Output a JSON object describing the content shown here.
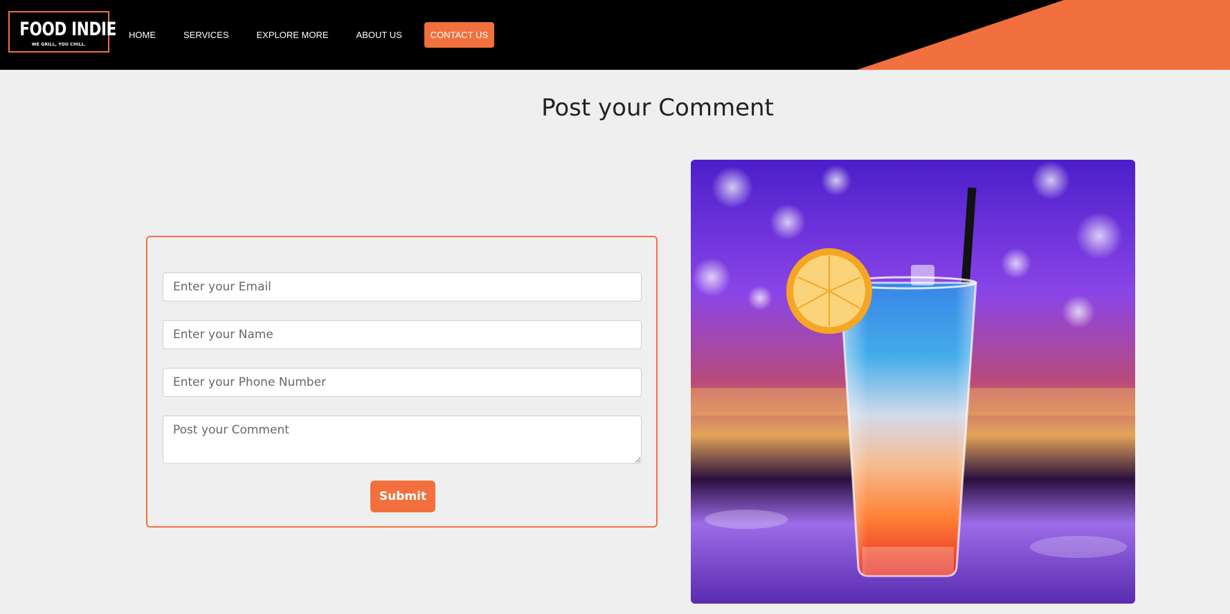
{
  "brand": {
    "name": "FOOD INDIE",
    "tagline": "WE GRILL, YOU CHILL."
  },
  "nav": {
    "links": [
      "HOME",
      "SERVICES",
      "EXPLORE MORE",
      "ABOUT US"
    ],
    "cta": "CONTACT US"
  },
  "main": {
    "title": "Post your Comment"
  },
  "form": {
    "email": {
      "value": "",
      "placeholder": "Enter your Email"
    },
    "name": {
      "value": "",
      "placeholder": "Enter your Name"
    },
    "phone": {
      "value": "",
      "placeholder": "Enter your Phone Number"
    },
    "comment": {
      "value": "",
      "placeholder": "Post your Comment"
    },
    "submit_label": "Submit"
  },
  "image": {
    "subject": "layered blue-orange-red cocktail with lemon slice and black straw on a bar counter"
  },
  "colors": {
    "accent": "#f2703d",
    "navbar": "#000000",
    "page_background": "#efefef"
  }
}
